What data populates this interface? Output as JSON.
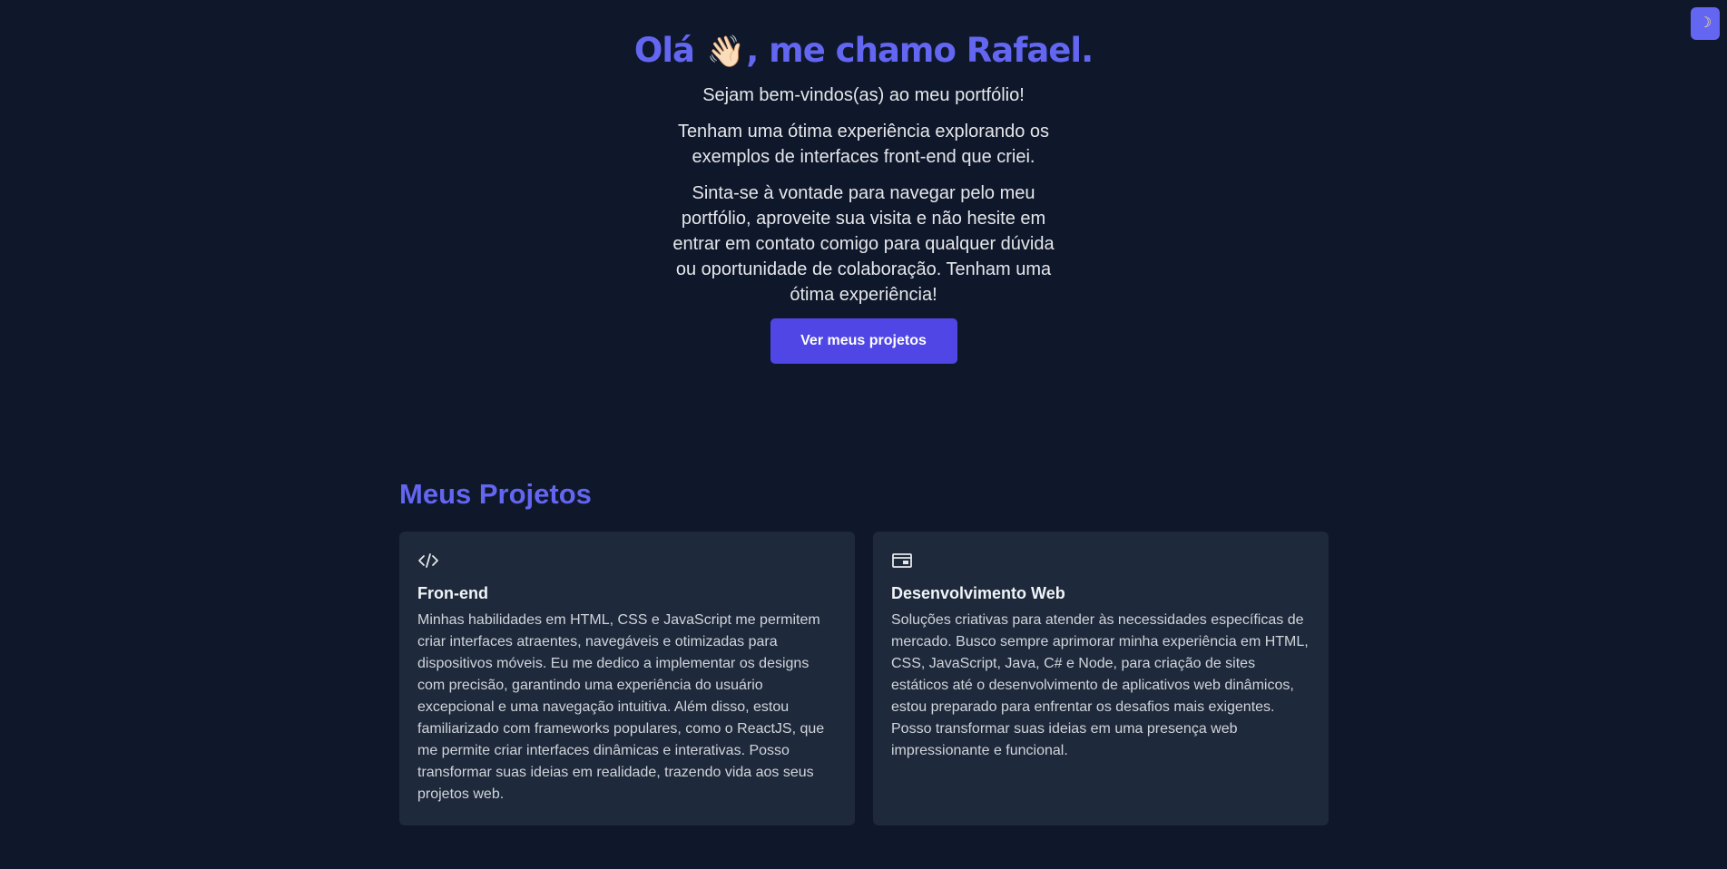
{
  "theme_toggle": {
    "icon": "moon-icon",
    "glyph": "☽"
  },
  "hero": {
    "title_before": "Olá",
    "wave_emoji": "👋🏻",
    "title_after": ", me chamo Rafael.",
    "paragraph_1": "Sejam bem-vindos(as) ao meu portfólio!",
    "paragraph_2": "Tenham uma ótima experiência explorando os exemplos de interfaces front-end que criei.",
    "paragraph_3": "Sinta-se à vontade para navegar pelo meu portfólio, aproveite sua visita e não hesite em entrar em contato comigo para qualquer dúvida ou oportunidade de colaboração. Tenham uma ótima experiência!",
    "cta_label": "Ver meus projetos"
  },
  "projects": {
    "heading": "Meus Projetos",
    "cards": [
      {
        "icon": "code-icon",
        "title": "Fron-end",
        "description": "Minhas habilidades em HTML, CSS e JavaScript me permitem criar interfaces atraentes, navegáveis e otimizadas para dispositivos móveis. Eu me dedico a implementar os designs com precisão, garantindo uma experiência do usuário excepcional e uma navegação intuitiva. Além disso, estou familiarizado com frameworks populares, como o ReactJS, que me permite criar interfaces dinâmicas e interativas. Posso transformar suas ideias em realidade, trazendo vida aos seus projetos web."
      },
      {
        "icon": "browser-window-icon",
        "title": "Desenvolvimento Web",
        "description": "Soluções criativas para atender às necessidades específicas de mercado. Busco sempre aprimorar minha experiência em HTML, CSS, JavaScript, Java, C# e Node, para criação de sites estáticos até o desenvolvimento de aplicativos web dinâmicos, estou preparado para enfrentar os desafios mais exigentes. Posso transformar suas ideias em uma presença web impressionante e funcional."
      }
    ]
  },
  "colors": {
    "background": "#0f172a",
    "accent": "#6366f1",
    "button": "#4f46e5",
    "card": "#1e293b"
  }
}
